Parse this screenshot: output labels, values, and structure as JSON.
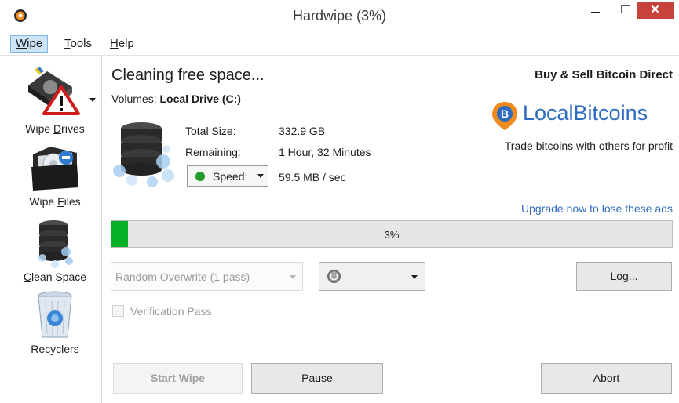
{
  "window": {
    "title": "Hardwipe (3%)",
    "close_glyph": "✕",
    "icons": {
      "app": "hardwipe-app-icon",
      "minimize": "minimize-icon",
      "maximize": "maximize-icon",
      "close": "close-icon"
    }
  },
  "menu": {
    "items": [
      {
        "first": "W",
        "rest": "ipe"
      },
      {
        "first": "T",
        "rest": "ools"
      },
      {
        "first": "H",
        "rest": "elp"
      }
    ]
  },
  "sidebar": {
    "items": [
      {
        "prefix": "Wipe ",
        "underline": "D",
        "suffix": "rives",
        "icon": "drive-warning-icon"
      },
      {
        "prefix": "Wipe ",
        "underline": "F",
        "suffix": "iles",
        "icon": "folder-icon"
      },
      {
        "prefix": "",
        "underline": "C",
        "suffix": "lean Space",
        "icon": "database-icon"
      },
      {
        "prefix": "",
        "underline": "R",
        "suffix": "ecyclers",
        "icon": "recycle-bin-icon"
      }
    ]
  },
  "status": {
    "heading": "Cleaning free space...",
    "volumes_label": "Volumes:",
    "volumes_value": "Local Drive (C:)",
    "total_size_label": "Total Size:",
    "total_size_value": "332.9 GB",
    "remaining_label": "Remaining:",
    "remaining_value": "1 Hour, 32 Minutes",
    "speed_label": "Speed:",
    "speed_value": "59.5 MB / sec",
    "speed_indicator_color": "#1f9a2b"
  },
  "ad": {
    "headline": "Buy & Sell Bitcoin Direct",
    "brand": "LocalBitcoins",
    "tagline": "Trade bitcoins with others for profit",
    "upgrade_link": "Upgrade now to lose these ads",
    "brand_color": "#2c6cc0"
  },
  "progress": {
    "text": "3%",
    "fraction": 0.03,
    "fill_color": "#06b025"
  },
  "options": {
    "method": "Random Overwrite (1 pass)",
    "verification_label": "Verification Pass",
    "verification_checked": false,
    "power_icon": "power-icon"
  },
  "buttons": {
    "log": "Log...",
    "start": "Start Wipe",
    "pause": "Pause",
    "abort": "Abort"
  }
}
